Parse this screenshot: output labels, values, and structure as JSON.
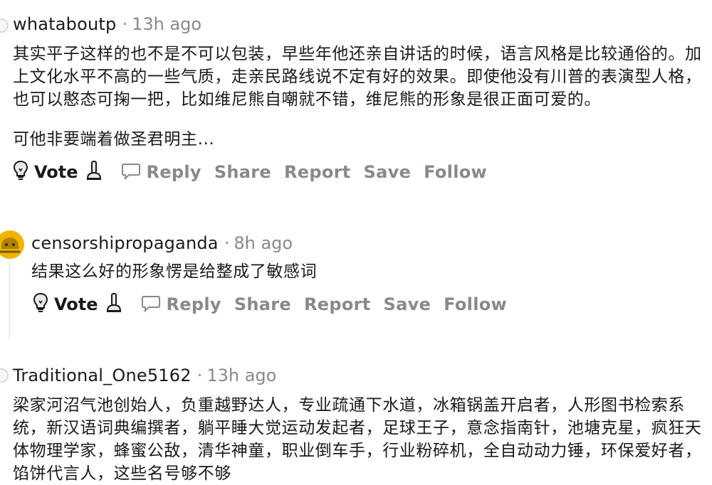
{
  "comments": [
    {
      "username": "whataboutp",
      "time": "13h ago",
      "paragraphs": [
        "其实平子这样的也不是不可以包装，早些年他还亲自讲话的时候，语言风格是比较通俗的。加上文化水平不高的一些气质，走亲民路线说不定有好的效果。即使他没有川普的表演型人格，也可以憨态可掬一把，比如维尼熊自嘲就不错，维尼熊的形象是很正面可爱的。",
        "可他非要端着做圣君明主..."
      ]
    },
    {
      "username": "censorshipropaganda",
      "time": "8h ago",
      "paragraphs": [
        "结果这么好的形象愣是给整成了敏感词"
      ]
    },
    {
      "username": "Traditional_One5162",
      "time": "13h ago",
      "paragraphs": [
        "梁家河沼气池创始人，负重越野达人，专业疏通下水道，冰箱锅盖开启者，人形图书检索系统，新汉语词典编撰者，躺平睡大觉运动发起者，足球王子，意念指南针，池塘克星，疯狂天体物理学家，蜂蜜公敌，清华神童，职业倒车手，行业粉碎机，全自动动力锤，环保爱好者，馅饼代言人，这些名号够不够"
      ]
    }
  ],
  "actions": {
    "vote": "Vote",
    "reply": "Reply",
    "share": "Share",
    "report": "Report",
    "save": "Save",
    "follow": "Follow"
  },
  "icons": {
    "upvote": "lightbulb-icon",
    "downvote": "plunger-icon",
    "reply": "speech-bubble-icon"
  },
  "colors": {
    "muted": "#878a8c",
    "text": "#1a1a1b",
    "avatar": "#f0b400"
  }
}
